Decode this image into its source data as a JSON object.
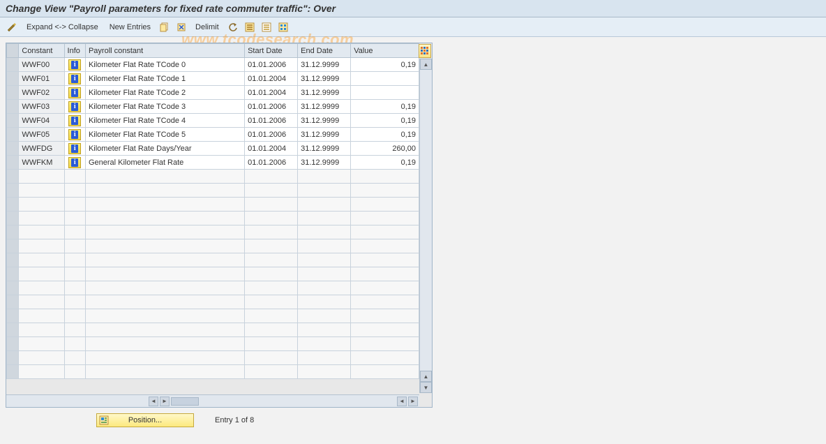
{
  "title": "Change View \"Payroll parameters for fixed rate commuter traffic\": Over",
  "watermark": "www.tcodesearch.com",
  "toolbar": {
    "expand_collapse": "Expand <-> Collapse",
    "new_entries": "New Entries",
    "delimit": "Delimit"
  },
  "columns": {
    "constant": "Constant",
    "info": "Info",
    "payroll": "Payroll constant",
    "start": "Start Date",
    "end": "End Date",
    "value": "Value"
  },
  "rows": [
    {
      "constant": "WWF00",
      "payroll": "Kilometer Flat Rate TCode 0",
      "start": "01.01.2006",
      "end": "31.12.9999",
      "value": "0,19"
    },
    {
      "constant": "WWF01",
      "payroll": "Kilometer Flat Rate TCode 1",
      "start": "01.01.2004",
      "end": "31.12.9999",
      "value": ""
    },
    {
      "constant": "WWF02",
      "payroll": "Kilometer Flat Rate TCode 2",
      "start": "01.01.2004",
      "end": "31.12.9999",
      "value": ""
    },
    {
      "constant": "WWF03",
      "payroll": "Kilometer Flat Rate TCode 3",
      "start": "01.01.2006",
      "end": "31.12.9999",
      "value": "0,19"
    },
    {
      "constant": "WWF04",
      "payroll": "Kilometer Flat Rate TCode 4",
      "start": "01.01.2006",
      "end": "31.12.9999",
      "value": "0,19"
    },
    {
      "constant": "WWF05",
      "payroll": "Kilometer Flat Rate TCode 5",
      "start": "01.01.2006",
      "end": "31.12.9999",
      "value": "0,19"
    },
    {
      "constant": "WWFDG",
      "payroll": "Kilometer Flat Rate Days/Year",
      "start": "01.01.2004",
      "end": "31.12.9999",
      "value": "260,00"
    },
    {
      "constant": "WWFKM",
      "payroll": "General Kilometer Flat Rate",
      "start": "01.01.2006",
      "end": "31.12.9999",
      "value": "0,19"
    }
  ],
  "empty_rows": 15,
  "footer": {
    "position": "Position...",
    "entry": "Entry 1 of 8"
  }
}
